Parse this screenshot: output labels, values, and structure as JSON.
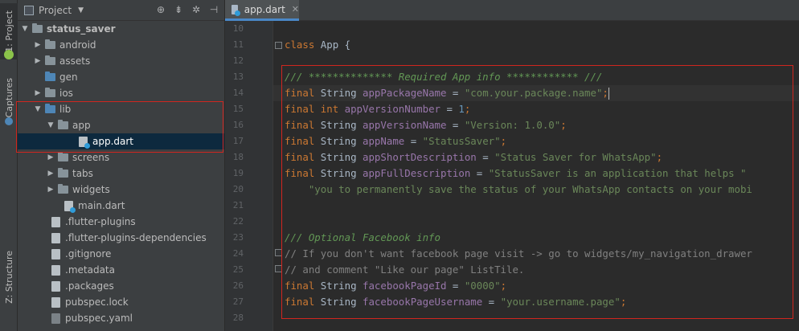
{
  "sidebar_strip": {
    "project_tab": "1: Project",
    "captures_tab": "Captures",
    "structure_tab": "Z: Structure"
  },
  "project_panel": {
    "title": "Project",
    "tree": [
      {
        "label": "status_saver",
        "type": "folder",
        "expanded": true
      },
      {
        "label": "android",
        "type": "folder"
      },
      {
        "label": "assets",
        "type": "folder"
      },
      {
        "label": "gen",
        "type": "folder"
      },
      {
        "label": "ios",
        "type": "folder"
      },
      {
        "label": "lib",
        "type": "folder",
        "expanded": true
      },
      {
        "label": "app",
        "type": "folder",
        "expanded": true
      },
      {
        "label": "app.dart",
        "type": "file",
        "selected": true
      },
      {
        "label": "screens",
        "type": "folder"
      },
      {
        "label": "tabs",
        "type": "folder"
      },
      {
        "label": "widgets",
        "type": "folder"
      },
      {
        "label": "main.dart",
        "type": "file"
      },
      {
        "label": ".flutter-plugins",
        "type": "file"
      },
      {
        "label": ".flutter-plugins-dependencies",
        "type": "file"
      },
      {
        "label": ".gitignore",
        "type": "file"
      },
      {
        "label": ".metadata",
        "type": "file"
      },
      {
        "label": ".packages",
        "type": "file"
      },
      {
        "label": "pubspec.lock",
        "type": "file"
      },
      {
        "label": "pubspec.yaml",
        "type": "file"
      }
    ]
  },
  "editor": {
    "tab_label": "app.dart",
    "line_numbers": [
      "10",
      "11",
      "12",
      "13",
      "14",
      "15",
      "16",
      "17",
      "18",
      "19",
      "20",
      "21",
      "22",
      "23",
      "24",
      "25",
      "26",
      "27",
      "28"
    ],
    "code": {
      "l11": {
        "kw": "class",
        "rest": " App {"
      },
      "l13": "/// ************** Required App info ************ ///",
      "l14": {
        "kw": "final",
        "ty": "String",
        "id": "appPackageName",
        "eq": " = ",
        "val": "\"com.your.package.name\"",
        "end": ";"
      },
      "l15": {
        "kw": "final",
        "ty": "int",
        "id": "appVersionNumber",
        "eq": " = ",
        "val": "1",
        "end": ";"
      },
      "l16": {
        "kw": "final",
        "ty": "String",
        "id": "appVersionName",
        "eq": " = ",
        "val": "\"Version: 1.0.0\"",
        "end": ";"
      },
      "l17": {
        "kw": "final",
        "ty": "String",
        "id": "appName",
        "eq": " = ",
        "val": "\"StatusSaver\"",
        "end": ";"
      },
      "l18": {
        "kw": "final",
        "ty": "String",
        "id": "appShortDescription",
        "eq": " = ",
        "val": "\"Status Saver for WhatsApp\"",
        "end": ";"
      },
      "l19": {
        "kw": "final",
        "ty": "String",
        "id": "appFullDescription",
        "eq": " = ",
        "val": "\"StatusSaver is an application that helps \""
      },
      "l20": "    \"you to permanently save the status of your WhatsApp contacts on your mobi",
      "l23": "/// Optional Facebook info",
      "l24": "// If you don't want facebook page visit -> go to widgets/my_navigation_drawer",
      "l25": "// and comment \"Like our page\" ListTile.",
      "l26": {
        "kw": "final",
        "ty": "String",
        "id": "facebookPageId",
        "eq": " = ",
        "val": "\"0000\"",
        "end": ";"
      },
      "l27": {
        "kw": "final",
        "ty": "String",
        "id": "facebookPageUsername",
        "eq": " = ",
        "val": "\"your.username.page\"",
        "end": ";"
      }
    }
  },
  "colors": {
    "highlight_box": "#d0261f",
    "keyword": "#cc7832",
    "string": "#6a8759",
    "field": "#9876aa",
    "number": "#6897bb"
  }
}
